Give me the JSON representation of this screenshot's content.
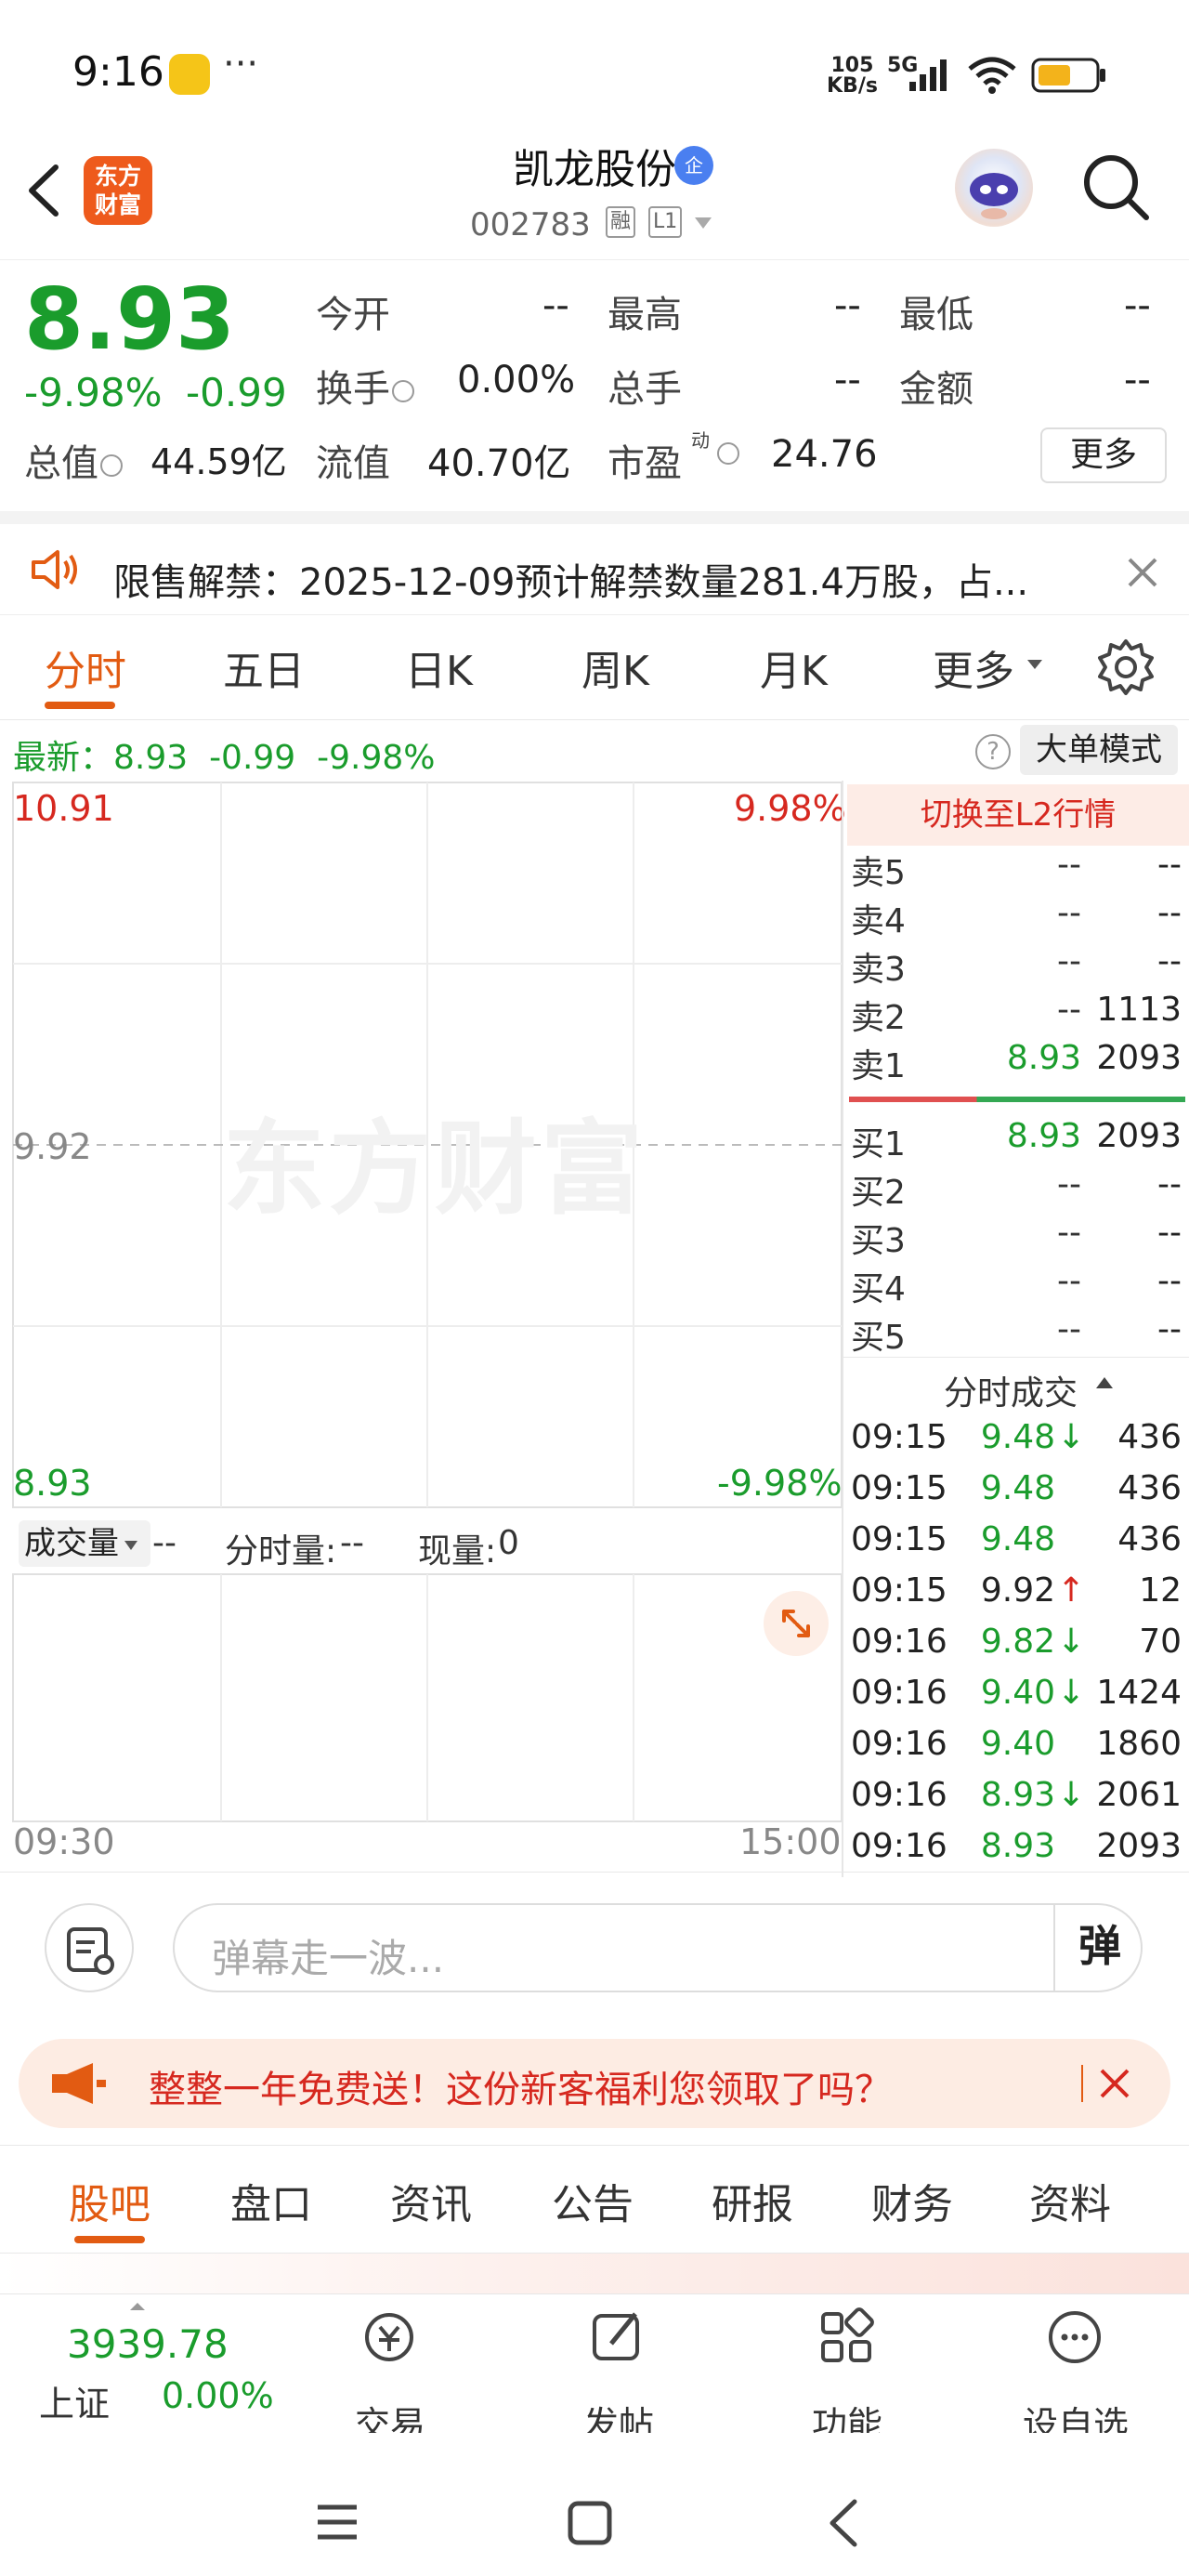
{
  "status": {
    "time": "9:16",
    "more": "···",
    "net_speed_top": "105",
    "net_speed_bottom": "KB/s",
    "network": "5G"
  },
  "header": {
    "stock_name": "凯龙股份",
    "verified_badge": "企",
    "code": "002783",
    "tag_rong": "融",
    "tag_level": "L1",
    "logo_line1": "东方",
    "logo_line2": "财富"
  },
  "quote": {
    "price": "8.93",
    "change_pct": "-9.98%",
    "change": "-0.99",
    "open_label": "今开",
    "open": "--",
    "high_label": "最高",
    "high": "--",
    "low_label": "最低",
    "low": "--",
    "turnover_label": "换手",
    "turnover": "0.00%",
    "volume_label": "总手",
    "volume": "--",
    "amount_label": "金额",
    "amount": "--",
    "mktcap_label": "总值",
    "mktcap": "44.59亿",
    "float_label": "流值",
    "float_cap": "40.70亿",
    "pe_label": "市盈",
    "pe_sup": "动",
    "pe": "24.76",
    "more_button": "更多"
  },
  "notice": {
    "text": "限售解禁：2025-12-09预计解禁数量281.4万股，占..."
  },
  "chart_tabs": [
    "分时",
    "五日",
    "日K",
    "周K",
    "月K",
    "更多"
  ],
  "chart": {
    "latest_label": "最新：",
    "latest_price": "8.93",
    "latest_change": "-0.99",
    "latest_pct": "-9.98%",
    "big_mode": "大单模式",
    "question": "?",
    "y_top": "10.91",
    "y_mid": "9.92",
    "y_bottom": "8.93",
    "pct_top": "9.98%",
    "pct_bottom": "-9.98%",
    "x_start": "09:30",
    "x_end": "15:00",
    "watermark": "东方财富",
    "vol_label": "成交量",
    "vol_value": "--",
    "min_vol_label": "分时量:",
    "min_vol_value": "--",
    "cur_vol_label": "现量:",
    "cur_vol_value": "0"
  },
  "order_book": {
    "l2_button": "切换至L2行情",
    "asks": [
      {
        "label": "卖5",
        "price": "--",
        "vol": "--"
      },
      {
        "label": "卖4",
        "price": "--",
        "vol": "--"
      },
      {
        "label": "卖3",
        "price": "--",
        "vol": "--"
      },
      {
        "label": "卖2",
        "price": "--",
        "vol": "1113"
      },
      {
        "label": "卖1",
        "price": "8.93",
        "vol": "2093"
      }
    ],
    "bids": [
      {
        "label": "买1",
        "price": "8.93",
        "vol": "2093"
      },
      {
        "label": "买2",
        "price": "--",
        "vol": "--"
      },
      {
        "label": "买3",
        "price": "--",
        "vol": "--"
      },
      {
        "label": "买4",
        "price": "--",
        "vol": "--"
      },
      {
        "label": "买5",
        "price": "--",
        "vol": "--"
      }
    ]
  },
  "ticks": {
    "title": "分时成交",
    "rows": [
      {
        "time": "09:15",
        "price": "9.48",
        "dir": "↓",
        "vol": "436",
        "color": "#1a9c2c"
      },
      {
        "time": "09:15",
        "price": "9.48",
        "dir": "",
        "vol": "436",
        "color": "#1a9c2c"
      },
      {
        "time": "09:15",
        "price": "9.48",
        "dir": "",
        "vol": "436",
        "color": "#1a9c2c"
      },
      {
        "time": "09:15",
        "price": "9.92",
        "dir": "↑",
        "vol": "12",
        "color": "#222222"
      },
      {
        "time": "09:16",
        "price": "9.82",
        "dir": "↓",
        "vol": "70",
        "color": "#1a9c2c"
      },
      {
        "time": "09:16",
        "price": "9.40",
        "dir": "↓",
        "vol": "1424",
        "color": "#1a9c2c"
      },
      {
        "time": "09:16",
        "price": "9.40",
        "dir": "",
        "vol": "1860",
        "color": "#1a9c2c"
      },
      {
        "time": "09:16",
        "price": "8.93",
        "dir": "↓",
        "vol": "2061",
        "color": "#1a9c2c"
      },
      {
        "time": "09:16",
        "price": "8.93",
        "dir": "",
        "vol": "2093",
        "color": "#1a9c2c"
      }
    ]
  },
  "danmu": {
    "placeholder": "弹幕走一波...",
    "send": "弹"
  },
  "promo": {
    "text": "整整一年免费送！这份新客福利您领取了吗？"
  },
  "bottom_tabs": [
    "股吧",
    "盘口",
    "资讯",
    "公告",
    "研报",
    "财务",
    "资料"
  ],
  "bottom_bar": {
    "index_value": "3939.78",
    "index_name": "上证",
    "index_change": "0.00%",
    "trade": "交易",
    "post": "发帖",
    "function": "功能",
    "watchlist": "设自选"
  },
  "colors": {
    "accent": "#e25b12",
    "up": "#d6281f",
    "down": "#1a9c2c"
  }
}
